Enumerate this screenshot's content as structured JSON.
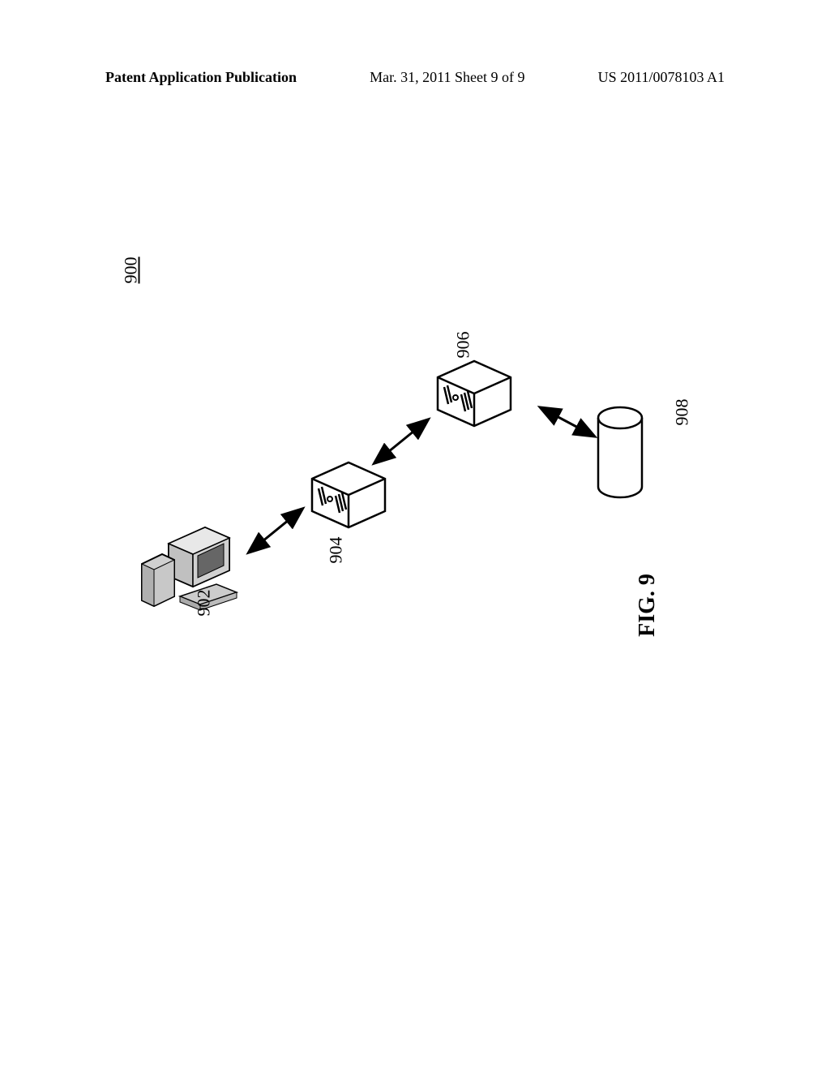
{
  "header": {
    "left": "Patent Application Publication",
    "center": "Mar. 31, 2011 Sheet 9 of 9",
    "right": "US 2011/0078103 A1"
  },
  "diagram": {
    "overall_number": "900",
    "labels": {
      "client": "902",
      "server1": "904",
      "server2": "906",
      "database": "908"
    },
    "caption": "FIG. 9"
  }
}
